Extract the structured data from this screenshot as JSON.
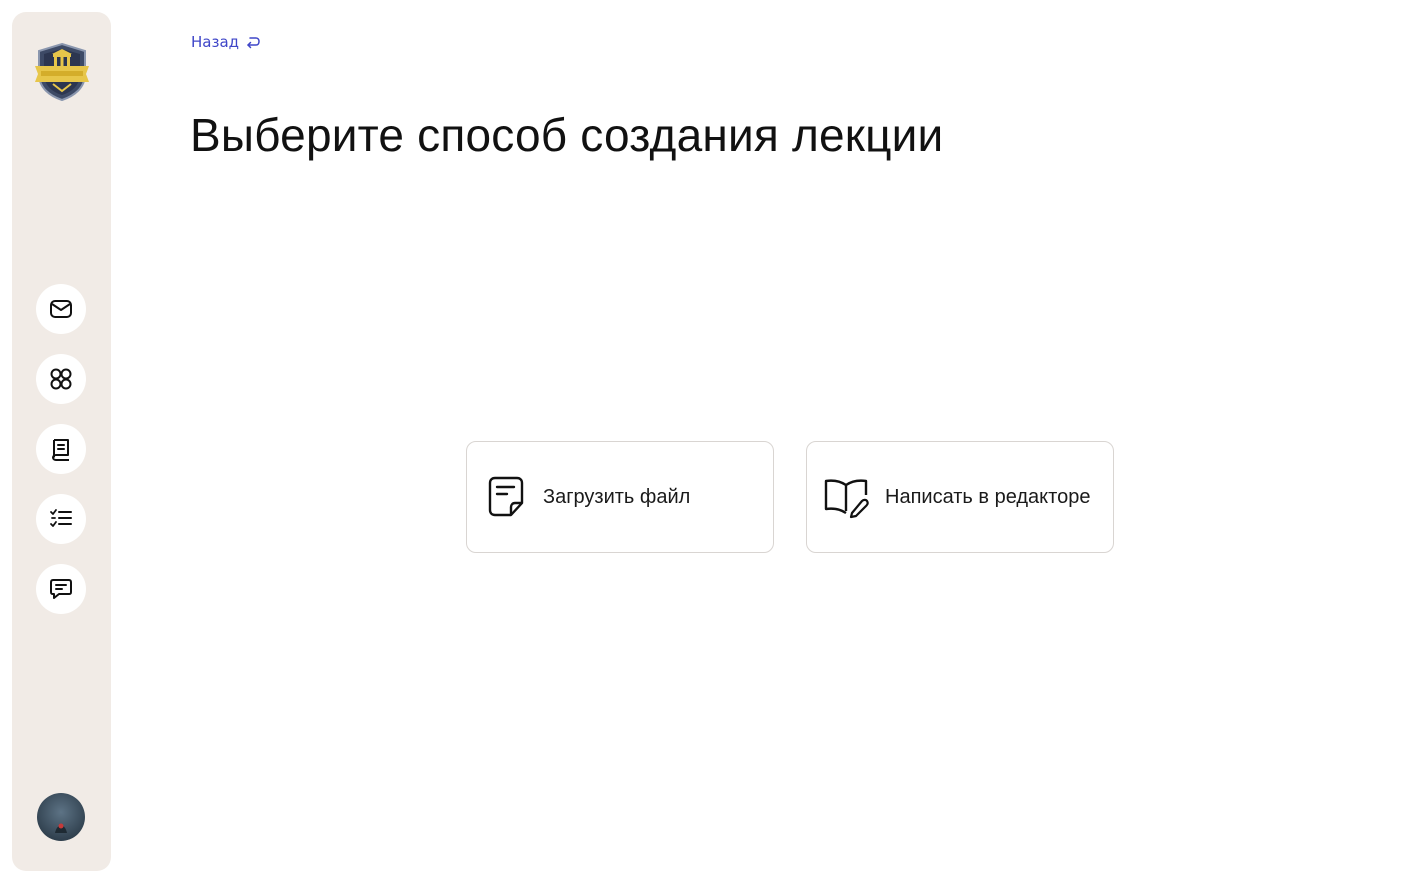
{
  "navigation": {
    "back_label": "Назад"
  },
  "page": {
    "title": "Выберите способ создания лекции"
  },
  "sidebar": {
    "logo_icon": "academy-shield-logo",
    "items": [
      {
        "icon": "mail-icon"
      },
      {
        "icon": "grid-icon"
      },
      {
        "icon": "book-icon"
      },
      {
        "icon": "checklist-icon"
      },
      {
        "icon": "chat-icon"
      }
    ],
    "avatar_icon": "user-avatar"
  },
  "options": {
    "upload_label": "Загрузить файл",
    "upload_icon": "document-icon",
    "editor_label": "Написать в редакторе",
    "editor_icon": "book-edit-icon"
  },
  "colors": {
    "sidebar_bg": "#f1ebe6",
    "link": "#3f46c8",
    "card_border": "#d9d5d2"
  }
}
